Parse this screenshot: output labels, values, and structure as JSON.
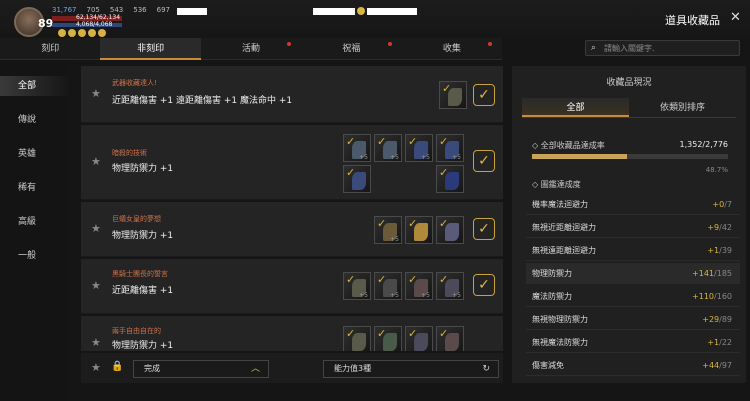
{
  "player": {
    "level": "89",
    "power": "31,767",
    "stat_a": "705",
    "stat_b": "543",
    "stat_c": "536",
    "stat_d": "697",
    "hp_text": "62,134/62,134",
    "mp_text": "4,068/4,068"
  },
  "window_title": "道具收藏品",
  "close_label": "✕",
  "tabs": [
    {
      "label": "刻印"
    },
    {
      "label": "非刻印"
    },
    {
      "label": "活動"
    },
    {
      "label": "祝福"
    },
    {
      "label": "收集"
    }
  ],
  "search": {
    "placeholder": "請輸入關鍵字."
  },
  "sidebar": {
    "items": [
      {
        "label": "全部"
      },
      {
        "label": "傳說"
      },
      {
        "label": "英雄"
      },
      {
        "label": "稀有"
      },
      {
        "label": "高級"
      },
      {
        "label": "一般"
      }
    ]
  },
  "entries": [
    {
      "name": "武器收藏達人!",
      "effect": "近距離傷害 +1 遠距離傷害 +1 魔法命中 +1",
      "slots": 1
    },
    {
      "name": "暗殺的技術",
      "effect": "物理防禦力 +1",
      "slots": 6,
      "slot_level": "+5"
    },
    {
      "name": "巨蟻女皇的夢想",
      "effect": "物理防禦力 +1",
      "slots": 3,
      "slot_level": "+5"
    },
    {
      "name": "黑騎士團長的誓言",
      "effect": "近距離傷害 +1",
      "slots": 4,
      "slot_level": "+5"
    },
    {
      "name": "兩手自由自在的",
      "effect": "物理防禦力 +1",
      "slots": 4
    }
  ],
  "bottom": {
    "filter_label": "完成",
    "ability_label": "能力值3種"
  },
  "right_panel": {
    "title": "收藏品現況",
    "tabs": [
      {
        "label": "全部"
      },
      {
        "label": "依類別排序"
      }
    ],
    "rate_label": "全部收藏品達成率",
    "rate_value": "1,352/2,776",
    "rate_fraction": 0.487,
    "rate_pct": "48.7%",
    "section_label": "圖鑑達成度",
    "stats": [
      {
        "label": "機率魔法迴避力",
        "gain": "+0",
        "max": "/7"
      },
      {
        "label": "無視近距離迴避力",
        "gain": "+9",
        "max": "/42"
      },
      {
        "label": "無視遠距離迴避力",
        "gain": "+1",
        "max": "/39"
      },
      {
        "label": "物理防禦力",
        "gain": "+141",
        "max": "/185"
      },
      {
        "label": "魔法防禦力",
        "gain": "+110",
        "max": "/160"
      },
      {
        "label": "無視物理防禦力",
        "gain": "+29",
        "max": "/89"
      },
      {
        "label": "無視魔法防禦力",
        "gain": "+1",
        "max": "/22"
      },
      {
        "label": "傷害減免",
        "gain": "+44",
        "max": "/97"
      }
    ]
  },
  "colors": {
    "accent": "#d8b640",
    "item_name": "#d0714a"
  }
}
